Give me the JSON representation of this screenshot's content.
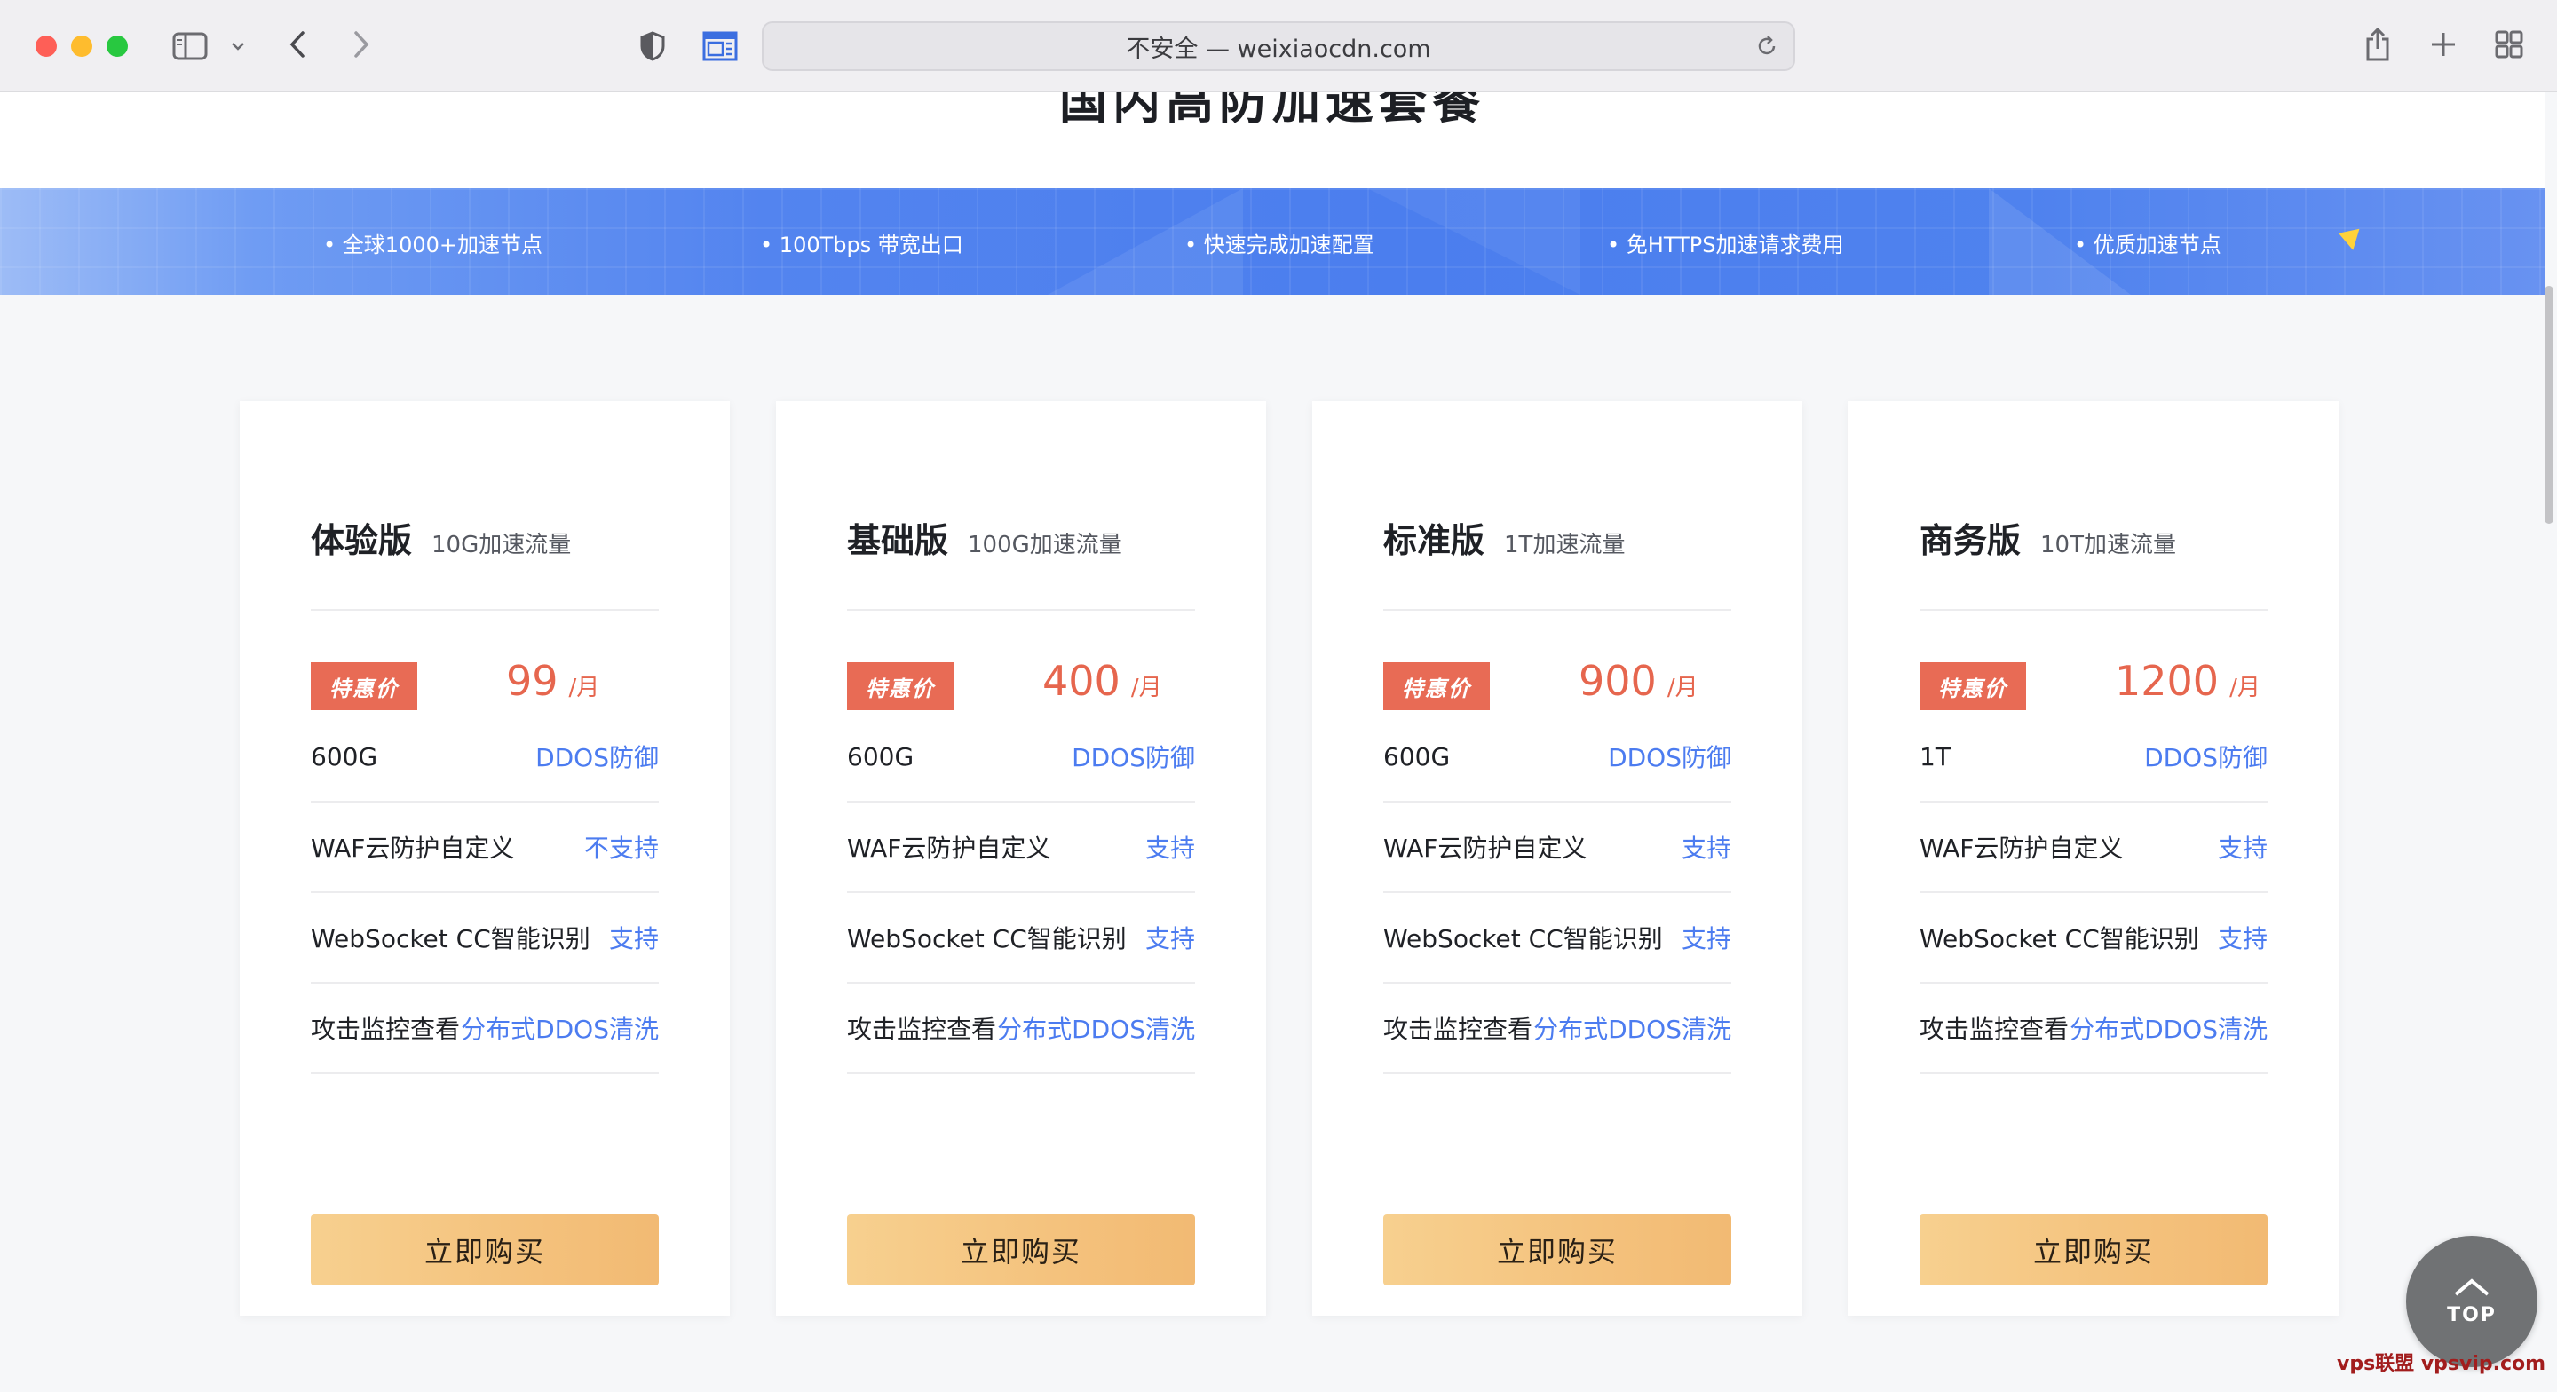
{
  "browser": {
    "url_display": "不安全 — weixiaocdn.com"
  },
  "page": {
    "section_title": "国内高防加速套餐",
    "banner_features": [
      "全球1000+加速节点",
      "100Tbps 带宽出口",
      "快速完成加速配置",
      "免HTTPS加速请求费用",
      "优质加速节点"
    ],
    "plans": [
      {
        "name": "体验版",
        "traffic": "10G加速流量",
        "badge": "特惠价",
        "price": "99",
        "unit": "/月",
        "rows": [
          {
            "label": "600G",
            "value": "DDOS防御"
          },
          {
            "label": "WAF云防护自定义",
            "value": "不支持"
          },
          {
            "label": "WebSocket CC智能识别",
            "value": "支持"
          },
          {
            "label": "攻击监控查看",
            "value": "分布式DDOS清洗"
          }
        ],
        "button": "立即购买"
      },
      {
        "name": "基础版",
        "traffic": "100G加速流量",
        "badge": "特惠价",
        "price": "400",
        "unit": "/月",
        "rows": [
          {
            "label": "600G",
            "value": "DDOS防御"
          },
          {
            "label": "WAF云防护自定义",
            "value": "支持"
          },
          {
            "label": "WebSocket CC智能识别",
            "value": "支持"
          },
          {
            "label": "攻击监控查看",
            "value": "分布式DDOS清洗"
          }
        ],
        "button": "立即购买"
      },
      {
        "name": "标准版",
        "traffic": "1T加速流量",
        "badge": "特惠价",
        "price": "900",
        "unit": "/月",
        "rows": [
          {
            "label": "600G",
            "value": "DDOS防御"
          },
          {
            "label": "WAF云防护自定义",
            "value": "支持"
          },
          {
            "label": "WebSocket CC智能识别",
            "value": "支持"
          },
          {
            "label": "攻击监控查看",
            "value": "分布式DDOS清洗"
          }
        ],
        "button": "立即购买"
      },
      {
        "name": "商务版",
        "traffic": "10T加速流量",
        "badge": "特惠价",
        "price": "1200",
        "unit": "/月",
        "rows": [
          {
            "label": "1T",
            "value": "DDOS防御"
          },
          {
            "label": "WAF云防护自定义",
            "value": "支持"
          },
          {
            "label": "WebSocket CC智能识别",
            "value": "支持"
          },
          {
            "label": "攻击监控查看",
            "value": "分布式DDOS清洗"
          }
        ],
        "button": "立即购买"
      }
    ],
    "back_to_top": "TOP",
    "watermark": "vps联盟  vpsvip.com"
  },
  "colors": {
    "accent_blue": "#4c7cf0",
    "price_red": "#e6664e",
    "badge_red": "#e86b55",
    "button_gold": "#f4c27d"
  },
  "icons": [
    "sidebar-icon",
    "chevron-down-icon",
    "back-arrow-icon",
    "forward-arrow-icon",
    "shield-icon",
    "reader-icon",
    "reload-icon",
    "share-icon",
    "new-tab-icon",
    "tab-overview-icon",
    "arrow-up-icon"
  ]
}
